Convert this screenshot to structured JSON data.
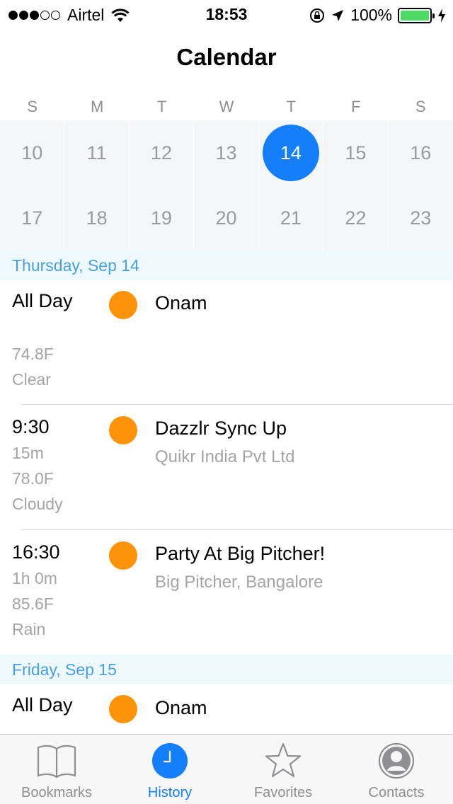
{
  "status_bar": {
    "carrier": "Airtel",
    "time": "18:53",
    "battery_percent": "100%",
    "signal_bars_filled": 3,
    "signal_bars_total": 5
  },
  "nav": {
    "title": "Calendar"
  },
  "weekdays": [
    "S",
    "M",
    "T",
    "W",
    "T",
    "F",
    "S"
  ],
  "calendar": {
    "days": [
      "10",
      "11",
      "12",
      "13",
      "14",
      "15",
      "16",
      "17",
      "18",
      "19",
      "20",
      "21",
      "22",
      "23"
    ],
    "selected": "14",
    "accent": "#147efb"
  },
  "sections": [
    {
      "header": "Thursday, Sep 14",
      "events": [
        {
          "time": "All Day",
          "duration": "",
          "temp": "74.8F",
          "weather": "Clear",
          "title": "Onam",
          "location": "",
          "color": "#fd9309"
        },
        {
          "time": "9:30",
          "duration": "15m",
          "temp": "78.0F",
          "weather": "Cloudy",
          "title": "Dazzlr Sync Up",
          "location": "Quikr India Pvt Ltd",
          "color": "#fd9309"
        },
        {
          "time": "16:30",
          "duration": "1h 0m",
          "temp": "85.6F",
          "weather": "Rain",
          "title": "Party At Big Pitcher!",
          "location": "Big Pitcher, Bangalore",
          "color": "#fd9309"
        }
      ]
    },
    {
      "header": "Friday, Sep 15",
      "events": [
        {
          "time": "All Day",
          "title": "Onam",
          "color": "#fd9309"
        }
      ]
    }
  ],
  "tabs": [
    {
      "label": "Bookmarks",
      "icon": "book-icon",
      "active": false
    },
    {
      "label": "History",
      "icon": "clock-icon",
      "active": true
    },
    {
      "label": "Favorites",
      "icon": "star-icon",
      "active": false
    },
    {
      "label": "Contacts",
      "icon": "person-icon",
      "active": false
    }
  ]
}
